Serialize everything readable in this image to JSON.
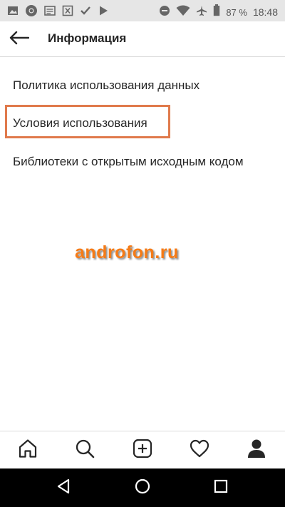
{
  "status_bar": {
    "icons_left": [
      "image-icon",
      "chrome-icon",
      "news-icon",
      "excel-icon",
      "check-app-icon",
      "play-store-icon"
    ],
    "icons_right": [
      "do-not-disturb-icon",
      "wifi-icon",
      "airplane-icon",
      "battery-icon"
    ],
    "battery_percent": "87 %",
    "time": "18:48"
  },
  "header": {
    "title": "Информация"
  },
  "menu": {
    "items": [
      {
        "label": "Политика использования данных"
      },
      {
        "label": "Условия использования"
      },
      {
        "label": "Библиотеки с открытым исходным кодом"
      }
    ]
  },
  "watermark": {
    "text": "androfon.ru"
  },
  "bottom_nav": {
    "items": [
      "home-icon",
      "search-icon",
      "add-post-icon",
      "activity-heart-icon",
      "profile-icon"
    ]
  },
  "system_nav": {
    "items": [
      "back-triangle-icon",
      "home-circle-icon",
      "recents-square-icon"
    ]
  },
  "colors": {
    "highlight": "#e07a4c",
    "watermark": "#f57b17"
  }
}
